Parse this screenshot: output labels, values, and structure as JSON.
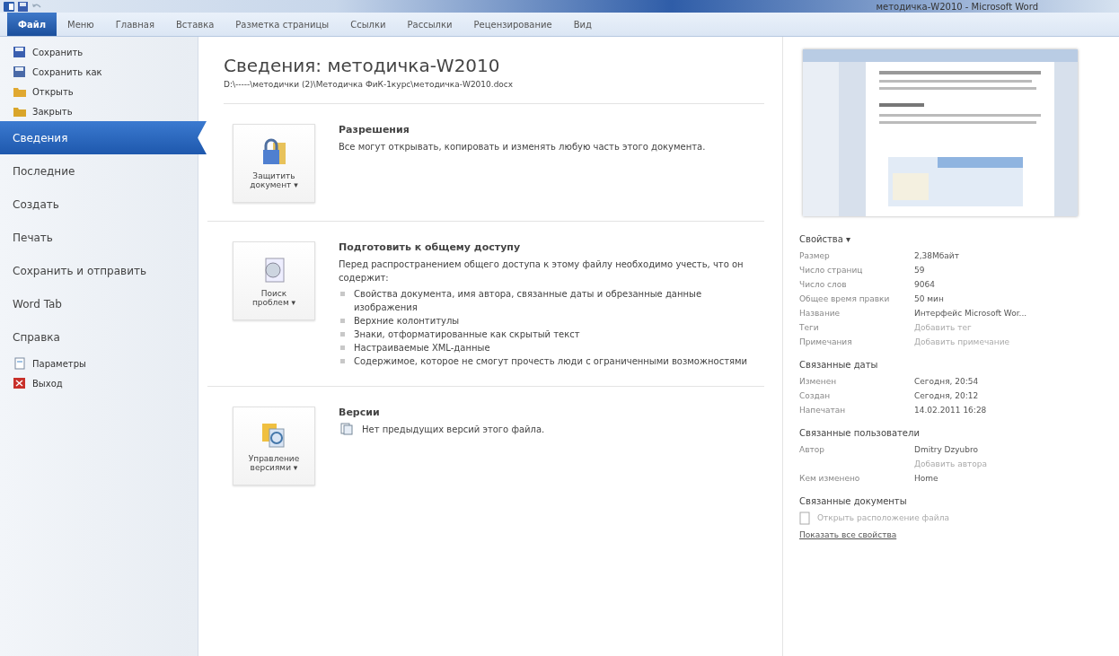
{
  "window": {
    "title": "методичка-W2010 - Microsoft Word"
  },
  "tabs": [
    {
      "label": "Файл",
      "selected": true
    },
    {
      "label": "Меню",
      "selected": false
    },
    {
      "label": "Главная",
      "selected": false
    },
    {
      "label": "Вставка",
      "selected": false
    },
    {
      "label": "Разметка страницы",
      "selected": false
    },
    {
      "label": "Ссылки",
      "selected": false
    },
    {
      "label": "Рассылки",
      "selected": false
    },
    {
      "label": "Рецензирование",
      "selected": false
    },
    {
      "label": "Вид",
      "selected": false
    }
  ],
  "sidebar": {
    "items": [
      {
        "label": "Сохранить",
        "kind": "command",
        "selected": false
      },
      {
        "label": "Сохранить как",
        "kind": "command",
        "selected": false
      },
      {
        "label": "Открыть",
        "kind": "command",
        "selected": false
      },
      {
        "label": "Закрыть",
        "kind": "command",
        "selected": false
      },
      {
        "label": "Сведения",
        "kind": "page",
        "selected": true
      },
      {
        "label": "Последние",
        "kind": "page",
        "selected": false
      },
      {
        "label": "Создать",
        "kind": "page",
        "selected": false
      },
      {
        "label": "Печать",
        "kind": "page",
        "selected": false
      },
      {
        "label": "Сохранить и отправить",
        "kind": "page",
        "selected": false
      },
      {
        "label": "Word Tab",
        "kind": "page",
        "selected": false
      },
      {
        "label": "Справка",
        "kind": "page",
        "selected": false
      },
      {
        "label": "Параметры",
        "kind": "command",
        "selected": false
      },
      {
        "label": "Выход",
        "kind": "command",
        "selected": false
      }
    ]
  },
  "info": {
    "title": "Сведения: методичка-W2010",
    "path": "D:\\-----\\методички (2)\\Методичка ФиК-1курс\\методичка-W2010.docx",
    "sections": [
      {
        "button": [
          "Защитить",
          "документ ▾"
        ],
        "heading": "Разрешения",
        "text": "Все могут открывать, копировать и изменять любую часть этого документа."
      },
      {
        "button": [
          "Поиск",
          "проблем ▾"
        ],
        "heading": "Подготовить к общему доступу",
        "text": "Перед распространением общего доступа к этому файлу необходимо учесть, что он содержит:",
        "bullets": [
          "Свойства документа, имя автора, связанные даты и обрезанные данные изображения",
          "Верхние колонтитулы",
          "Знаки, отформатированные как скрытый текст",
          "Настраиваемые XML-данные",
          "Содержимое, которое не смогут прочесть люди с ограниченными возможностями"
        ]
      },
      {
        "button": [
          "Управление",
          "версиями ▾"
        ],
        "heading": "Версии",
        "note": "Нет предыдущих версий этого файла."
      }
    ]
  },
  "properties": {
    "groups": [
      {
        "heading": "Свойства ▾",
        "rows": [
          {
            "label": "Размер",
            "value": "2,38Мбайт"
          },
          {
            "label": "Число страниц",
            "value": "59"
          },
          {
            "label": "Число слов",
            "value": "9064"
          },
          {
            "label": "Общее время правки",
            "value": "50 мин"
          },
          {
            "label": "Название",
            "value": "Интерфейс Microsoft Wor..."
          },
          {
            "label": "Теги",
            "placeholder": "Добавить тег"
          },
          {
            "label": "Примечания",
            "placeholder": "Добавить примечание"
          }
        ]
      },
      {
        "heading": "Связанные даты",
        "rows": [
          {
            "label": "Изменен",
            "value": "Сегодня, 20:54"
          },
          {
            "label": "Создан",
            "value": "Сегодня, 20:12"
          },
          {
            "label": "Напечатан",
            "value": "14.02.2011 16:28"
          }
        ]
      },
      {
        "heading": "Связанные пользователи",
        "rows": [
          {
            "label": "Автор",
            "value": "Dmitry Dzyubro"
          },
          {
            "placeholder": "Добавить автора"
          },
          {
            "label": "Кем изменено",
            "value": "Home"
          }
        ]
      }
    ],
    "related": {
      "heading": "Связанные документы",
      "open_location": "Открыть расположение файла",
      "show_all": "Показать все свойства"
    }
  }
}
